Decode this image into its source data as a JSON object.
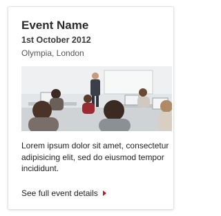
{
  "event": {
    "title": "Event Name",
    "date": "1st October 2012",
    "venue": "Olympia, London",
    "description": "Lorem ipsum dolor sit amet, consectetur adipisicing elit, sed do eiusmod tempor incididunt.",
    "details_link": "See full event details"
  },
  "colors": {
    "accent": "#c0142c"
  },
  "icons": {
    "details_arrow": "caret-right-icon"
  }
}
